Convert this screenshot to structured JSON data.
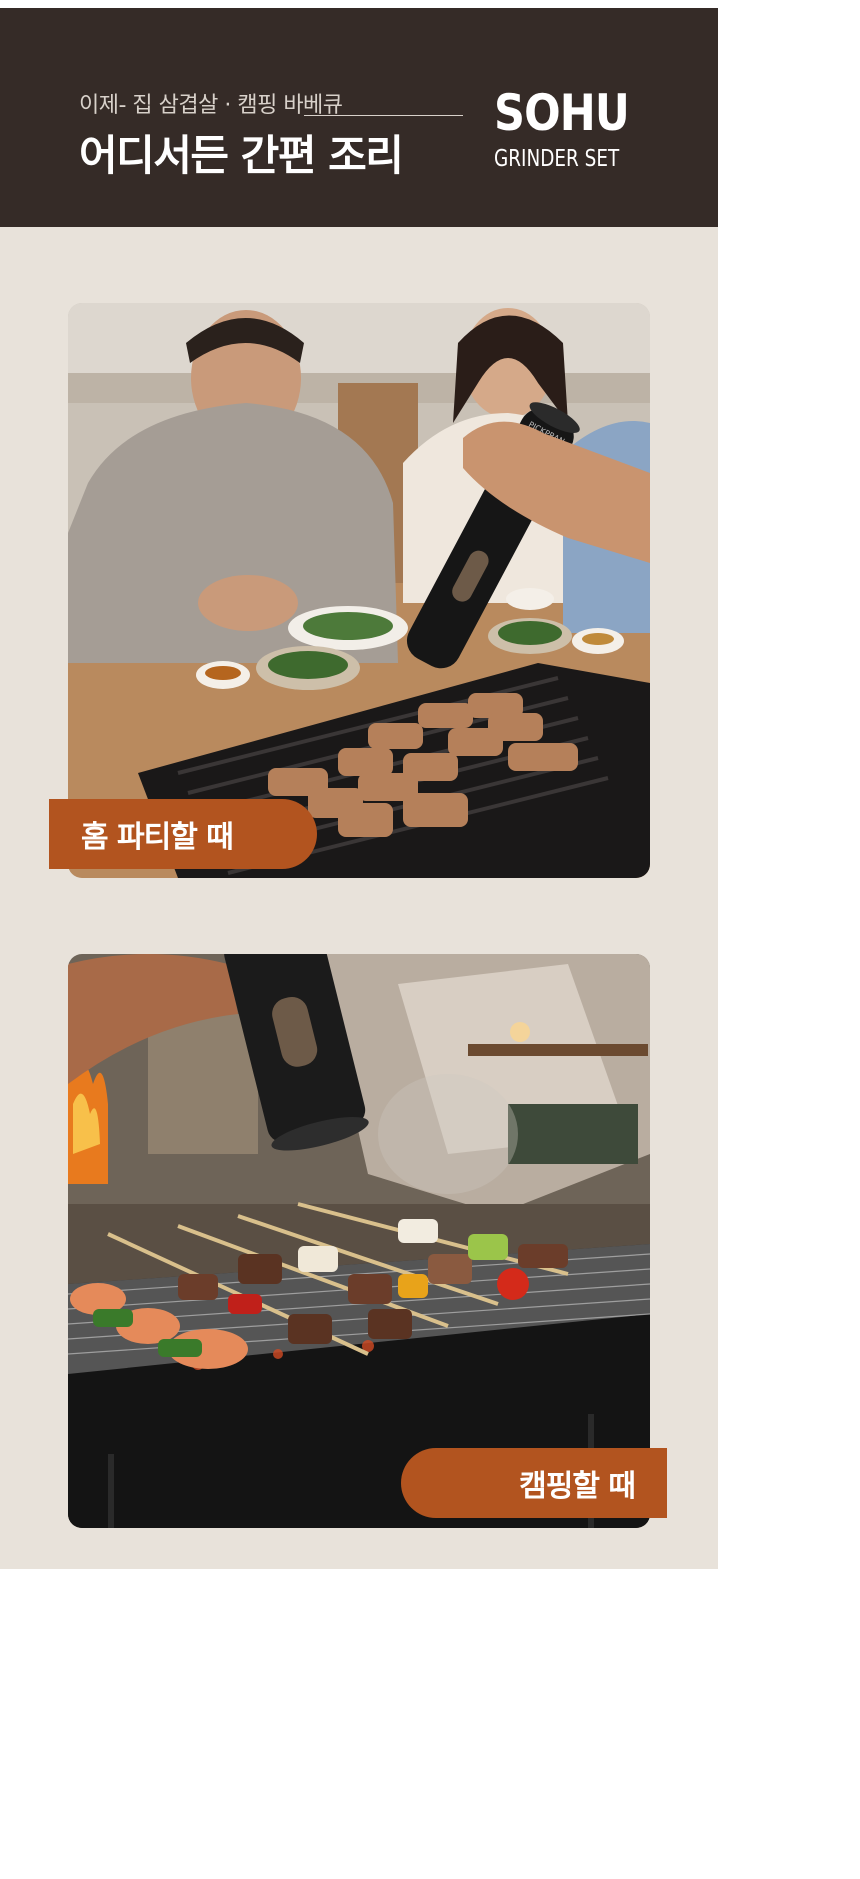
{
  "header": {
    "subtitle": "이제- 집 삼겹살 · 캠핑 바베큐",
    "title": "어디서든 간편 조리",
    "brand": "SOHU",
    "brand_sub": "GRINDER SET"
  },
  "sections": [
    {
      "label": "홈 파티할 때",
      "photo_icon": "home-party-bbq-photo",
      "grinder_mark": "PICKPRAN"
    },
    {
      "label": "캠핑할 때",
      "photo_icon": "camping-skewer-grill-photo"
    }
  ],
  "colors": {
    "background": "#e8e2da",
    "header": "#352b27",
    "label": "#b2541f"
  }
}
